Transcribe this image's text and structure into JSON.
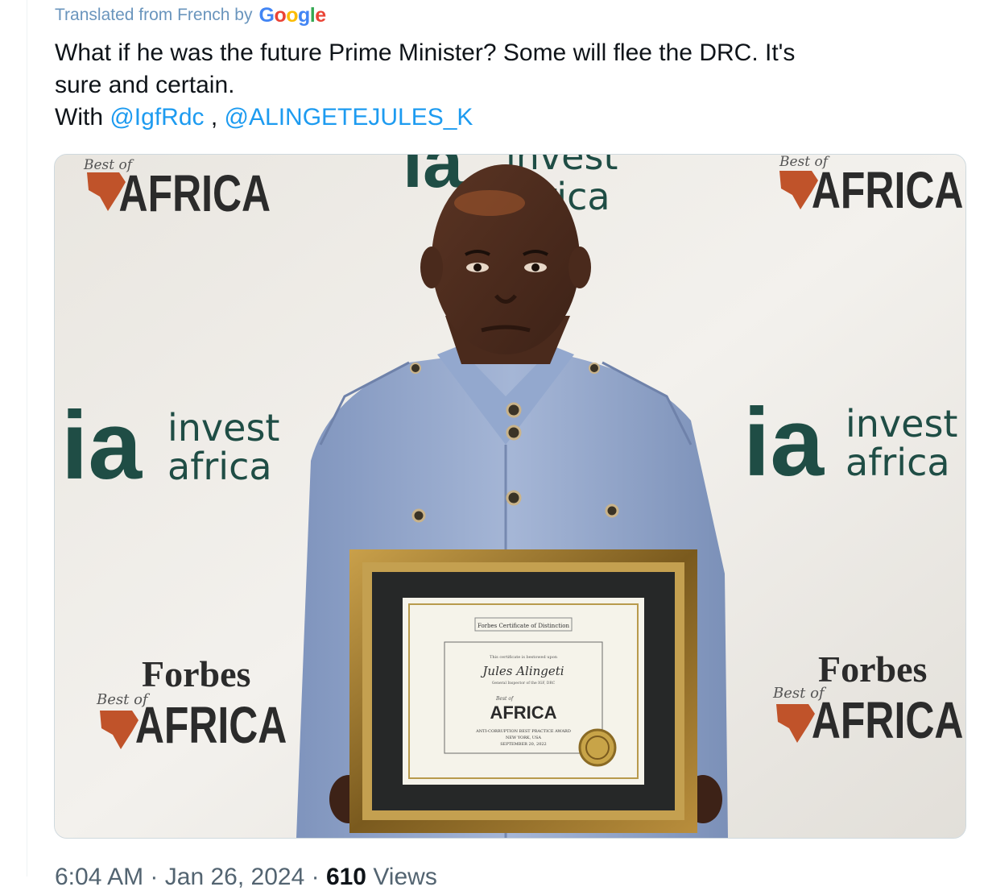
{
  "translation": {
    "prefix": "Translated from French by",
    "brand": "Google",
    "brand_colors": [
      "#4285F4",
      "#EA4335",
      "#FBBC05",
      "#4285F4",
      "#34A853",
      "#EA4335"
    ]
  },
  "tweet": {
    "line1": "What if he was the future Prime Minister? Some will flee the DRC. It's",
    "line2": "sure and certain.",
    "with_label": "With",
    "mention1": "@IgfRdc",
    "separator": ",",
    "mention2": "@ALINGETEJULES_K"
  },
  "media": {
    "backdrop": {
      "best_of": "Best of",
      "africa": "AFRICA",
      "invest": "invest",
      "africa_lower": "africa",
      "ia": "ia",
      "forbes": "Forbes"
    },
    "certificate": {
      "header": "Forbes Certificate of Distinction",
      "bestowed": "This certificate is bestowed upon",
      "name": "Jules Alingeti",
      "role": "General Inspector of the IGF, DRC",
      "best_of": "Best of",
      "africa": "AFRICA",
      "award": "ANTI-CORRUPTION BEST PRACTICE AWARD",
      "place": "NEW YORK, USA",
      "date": "SEPTEMBER 20, 2022"
    }
  },
  "footer": {
    "time": "6:04 AM",
    "dot": "·",
    "date": "Jan 26, 2024",
    "views_count": "610",
    "views_label": "Views"
  },
  "colors": {
    "mention": "#1d9bf0",
    "text": "#0f1419",
    "muted": "#536471",
    "ia_green": "#1f4d45",
    "suit": "#8ea3c9"
  }
}
